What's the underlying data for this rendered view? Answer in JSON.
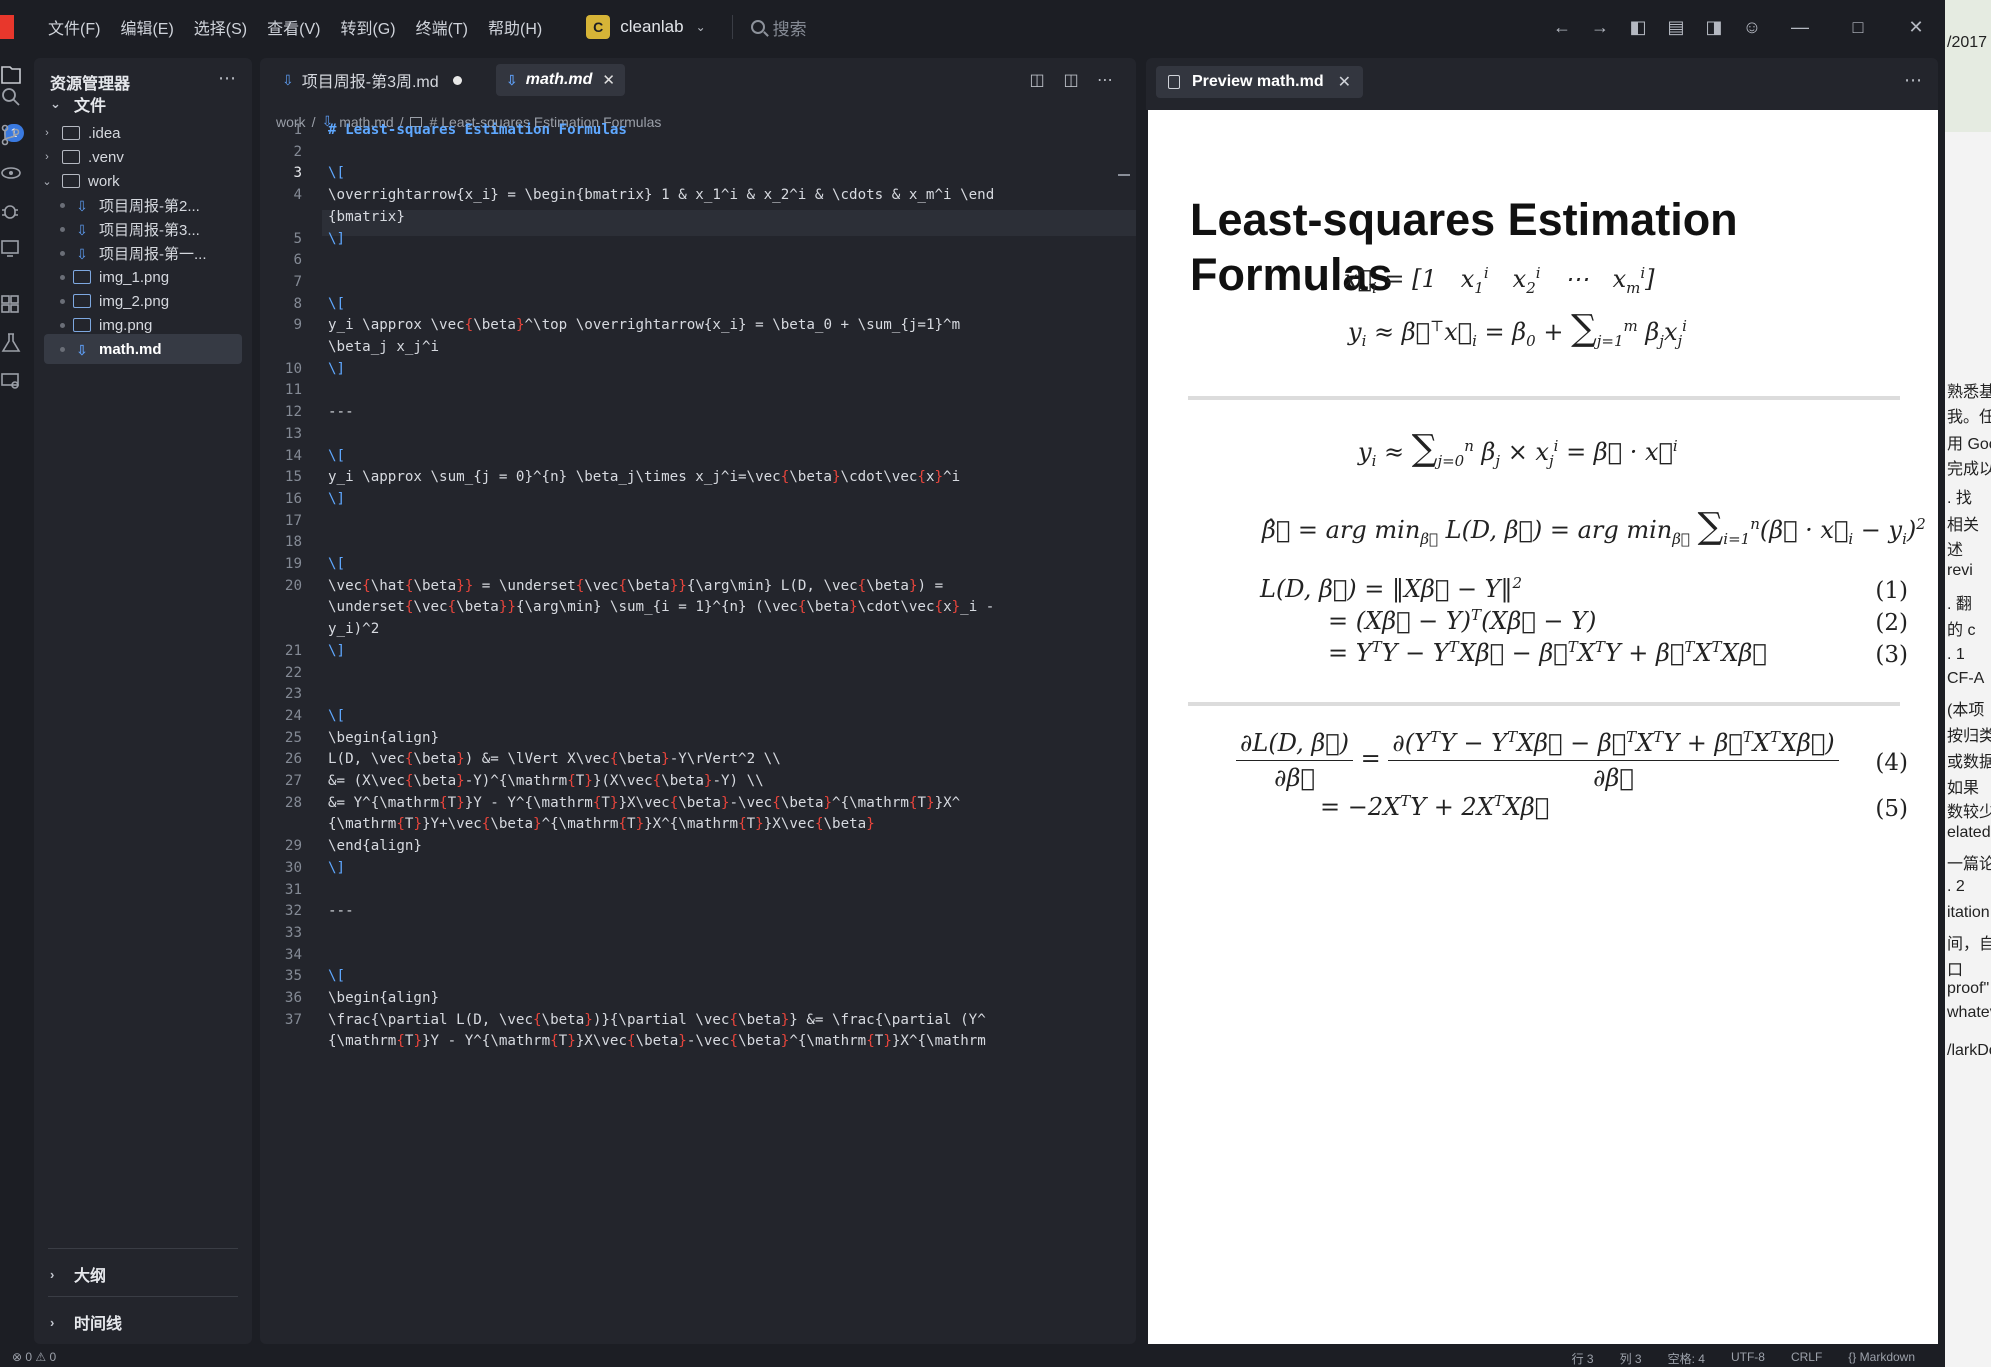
{
  "menu": [
    "文件(F)",
    "编辑(E)",
    "选择(S)",
    "查看(V)",
    "转到(G)",
    "终端(T)",
    "帮助(H)"
  ],
  "workspace": {
    "badge": "C",
    "name": "cleanlab"
  },
  "search": {
    "placeholder": "搜索"
  },
  "activity": {
    "explorer_badge": "1"
  },
  "sidebar": {
    "title": "资源管理器",
    "section": "文件",
    "tree": [
      {
        "label": ".idea",
        "type": "folder"
      },
      {
        "label": ".venv",
        "type": "folder"
      },
      {
        "label": "work",
        "type": "folder"
      },
      {
        "label": "项目周报-第2...",
        "type": "md"
      },
      {
        "label": "项目周报-第3...",
        "type": "md"
      },
      {
        "label": "项目周报-第一...",
        "type": "md"
      },
      {
        "label": "img_1.png",
        "type": "img"
      },
      {
        "label": "img_2.png",
        "type": "img"
      },
      {
        "label": "img.png",
        "type": "img"
      },
      {
        "label": "math.md",
        "type": "md"
      }
    ],
    "outline": "大纲",
    "timeline": "时间线"
  },
  "editor": {
    "tabs": [
      {
        "label": "项目周报-第3周.md"
      },
      {
        "label": "math.md"
      }
    ],
    "breadcrumb": {
      "folder": "work",
      "file": "math.md",
      "symbol": "# Least-squares Estimation Formulas"
    },
    "code_lines": [
      {
        "n": "1",
        "t": "# Least-squares Estimation Formulas"
      },
      {
        "n": "2",
        "t": ""
      },
      {
        "n": "3",
        "t": "\\["
      },
      {
        "n": "4",
        "t": "\\overrightarrow{x_i} = \\begin{bmatrix} 1 & x_1^i & x_2^i & \\cdots & x_m^i \\end"
      },
      {
        "n": "",
        "t": "{bmatrix}"
      },
      {
        "n": "5",
        "t": "\\]"
      },
      {
        "n": "6",
        "t": ""
      },
      {
        "n": "7",
        "t": ""
      },
      {
        "n": "8",
        "t": "\\["
      },
      {
        "n": "9",
        "t": "y_i \\approx \\vec{\\beta}^\\top \\overrightarrow{x_i} = \\beta_0 + \\sum_{j=1}^m"
      },
      {
        "n": "",
        "t": "\\beta_j x_j^i"
      },
      {
        "n": "10",
        "t": "\\]"
      },
      {
        "n": "11",
        "t": ""
      },
      {
        "n": "12",
        "t": "---"
      },
      {
        "n": "13",
        "t": ""
      },
      {
        "n": "14",
        "t": "\\["
      },
      {
        "n": "15",
        "t": "y_i \\approx \\sum_{j = 0}^{n} \\beta_j\\times x_j^i=\\vec{\\beta}\\cdot\\vec{x}^i"
      },
      {
        "n": "16",
        "t": "\\]"
      },
      {
        "n": "17",
        "t": ""
      },
      {
        "n": "18",
        "t": ""
      },
      {
        "n": "19",
        "t": "\\["
      },
      {
        "n": "20",
        "t": "\\vec{\\hat{\\beta}} = \\underset{\\vec{\\beta}}{\\arg\\min} L(D, \\vec{\\beta}) ="
      },
      {
        "n": "",
        "t": "\\underset{\\vec{\\beta}}{\\arg\\min} \\sum_{i = 1}^{n} (\\vec{\\beta}\\cdot\\vec{x}_i -"
      },
      {
        "n": "",
        "t": "y_i)^2"
      },
      {
        "n": "21",
        "t": "\\]"
      },
      {
        "n": "22",
        "t": ""
      },
      {
        "n": "23",
        "t": ""
      },
      {
        "n": "24",
        "t": "\\["
      },
      {
        "n": "25",
        "t": "\\begin{align}"
      },
      {
        "n": "26",
        "t": "L(D, \\vec{\\beta}) &= \\lVert X\\vec{\\beta}-Y\\rVert^2 \\\\"
      },
      {
        "n": "27",
        "t": "&= (X\\vec{\\beta}-Y)^{\\mathrm{T}}(X\\vec{\\beta}-Y) \\\\"
      },
      {
        "n": "28",
        "t": "&= Y^{\\mathrm{T}}Y - Y^{\\mathrm{T}}X\\vec{\\beta}-\\vec{\\beta}^{\\mathrm{T}}X^"
      },
      {
        "n": "",
        "t": "{\\mathrm{T}}Y+\\vec{\\beta}^{\\mathrm{T}}X^{\\mathrm{T}}X\\vec{\\beta}"
      },
      {
        "n": "29",
        "t": "\\end{align}"
      },
      {
        "n": "30",
        "t": "\\]"
      },
      {
        "n": "31",
        "t": ""
      },
      {
        "n": "32",
        "t": "---"
      },
      {
        "n": "33",
        "t": ""
      },
      {
        "n": "34",
        "t": ""
      },
      {
        "n": "35",
        "t": "\\["
      },
      {
        "n": "36",
        "t": "\\begin{align}"
      },
      {
        "n": "37",
        "t": "\\frac{\\partial L(D, \\vec{\\beta})}{\\partial \\vec{\\beta}} &= \\frac{\\partial (Y^"
      },
      {
        "n": "",
        "t": "{\\mathrm{T}}Y - Y^{\\mathrm{T}}X\\vec{\\beta}-\\vec{\\beta}^{\\mathrm{T}}X^{\\mathrm"
      }
    ]
  },
  "preview": {
    "tab_label": "Preview math.md",
    "title": "Least-squares Estimation Formulas",
    "eq_numbers": [
      "(1)",
      "(2)",
      "(3)",
      "(4)",
      "(5)"
    ]
  },
  "background_window": {
    "top_text": "/2017",
    "lines": [
      "熟悉基",
      "我。任",
      "用 Goo",
      "完成以",
      ". 找",
      "相关",
      "述",
      "revi",
      ". 翻",
      "的 c",
      ". 1",
      "CF-A",
      "(本项",
      "按归类",
      "或数据",
      "如果",
      "数较少",
      "elated",
      "一篇论",
      ". 2",
      "itation",
      "间，自适",
      "口",
      "proof\"",
      "whatev",
      "/larkDo"
    ]
  },
  "statusbar": {
    "left": "⊗ 0 ⚠ 0",
    "right": [
      "行 3",
      "列 3",
      "空格: 4",
      "UTF-8",
      "CRLF",
      "{} Markdown"
    ]
  },
  "colors": {
    "accent_blue": "#5fa8ff",
    "latex_red": "#e8453c",
    "editor_bg": "#23252c",
    "preview_bg": "#ffffff"
  }
}
